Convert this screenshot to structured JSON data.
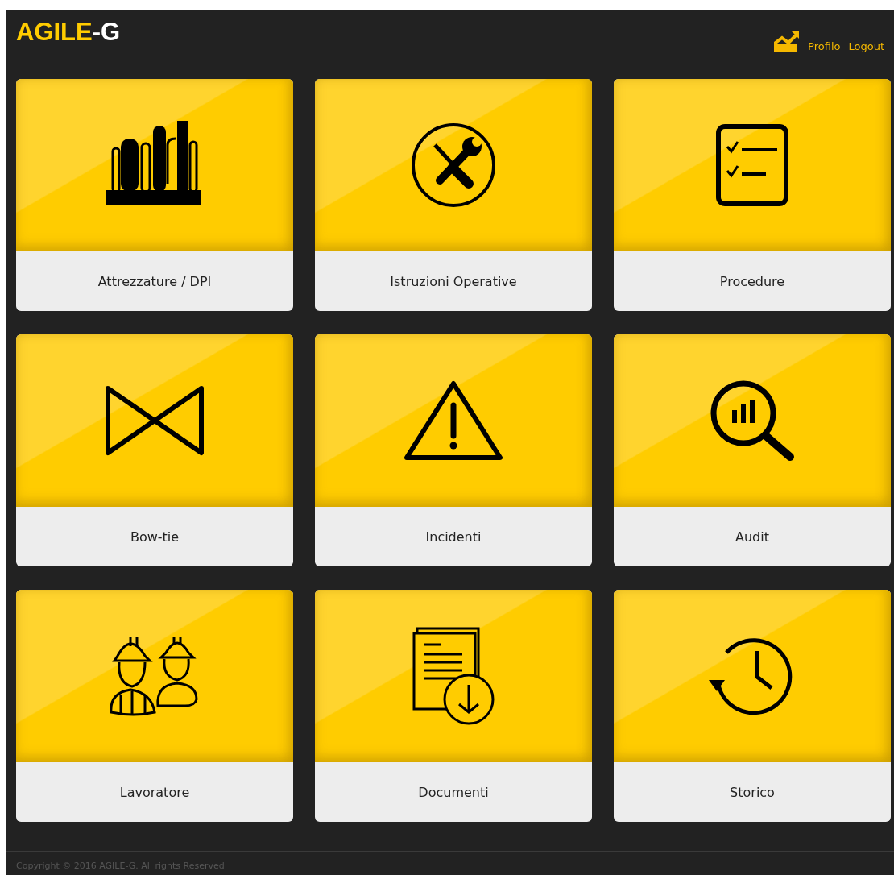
{
  "header": {
    "logo_bold": "AGILE",
    "logo_rest": "-G",
    "links": [
      "Profilo",
      "Logout"
    ]
  },
  "tiles": [
    {
      "kind": "plant",
      "label": "Attrezzature / DPI"
    },
    {
      "kind": "tools",
      "label": "Istruzioni Operative"
    },
    {
      "kind": "checklist",
      "label": "Procedure"
    },
    {
      "kind": "bowtie",
      "label": "Bow-tie"
    },
    {
      "kind": "warning",
      "label": "Incidenti"
    },
    {
      "kind": "audit",
      "label": "Audit"
    },
    {
      "kind": "workers",
      "label": "Lavoratore"
    },
    {
      "kind": "documents",
      "label": "Documenti"
    },
    {
      "kind": "history",
      "label": "Storico"
    }
  ],
  "footer": {
    "copyright": "Copyright © 2016 AGILE-G. All rights Reserved"
  }
}
